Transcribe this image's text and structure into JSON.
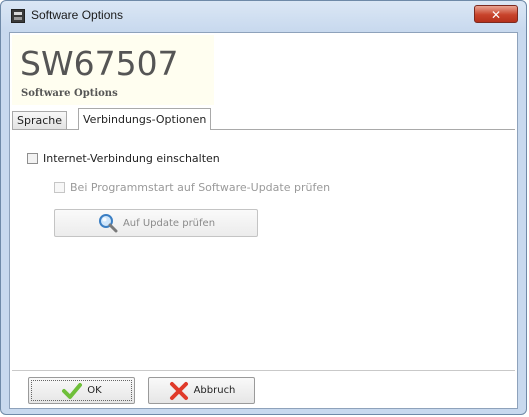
{
  "window": {
    "title": "Software Options",
    "close_label": "✕"
  },
  "header": {
    "model": "SW67507",
    "subtitle": "Software Options"
  },
  "tabs": [
    {
      "label": "Sprache",
      "active": false
    },
    {
      "label": "Verbindungs-Optionen",
      "active": true
    }
  ],
  "options": {
    "internet_label": "Internet-Verbindung einschalten",
    "internet_checked": false,
    "startup_label": "Bei Programmstart auf Software-Update prüfen",
    "startup_checked": false,
    "update_button_label": "Auf Update prüfen"
  },
  "footer": {
    "ok_label": "OK",
    "cancel_label": "Abbruch"
  },
  "icons": {
    "app": "app-icon",
    "search": "magnifier-icon",
    "ok": "checkmark-icon",
    "cancel": "red-x-icon"
  },
  "colors": {
    "title_bg": "#c8d9ee",
    "close_button": "#c8432b",
    "header_bg": "#fffef0",
    "ok_check": "#6fbf3a",
    "cancel_x": "#e03a2a"
  }
}
